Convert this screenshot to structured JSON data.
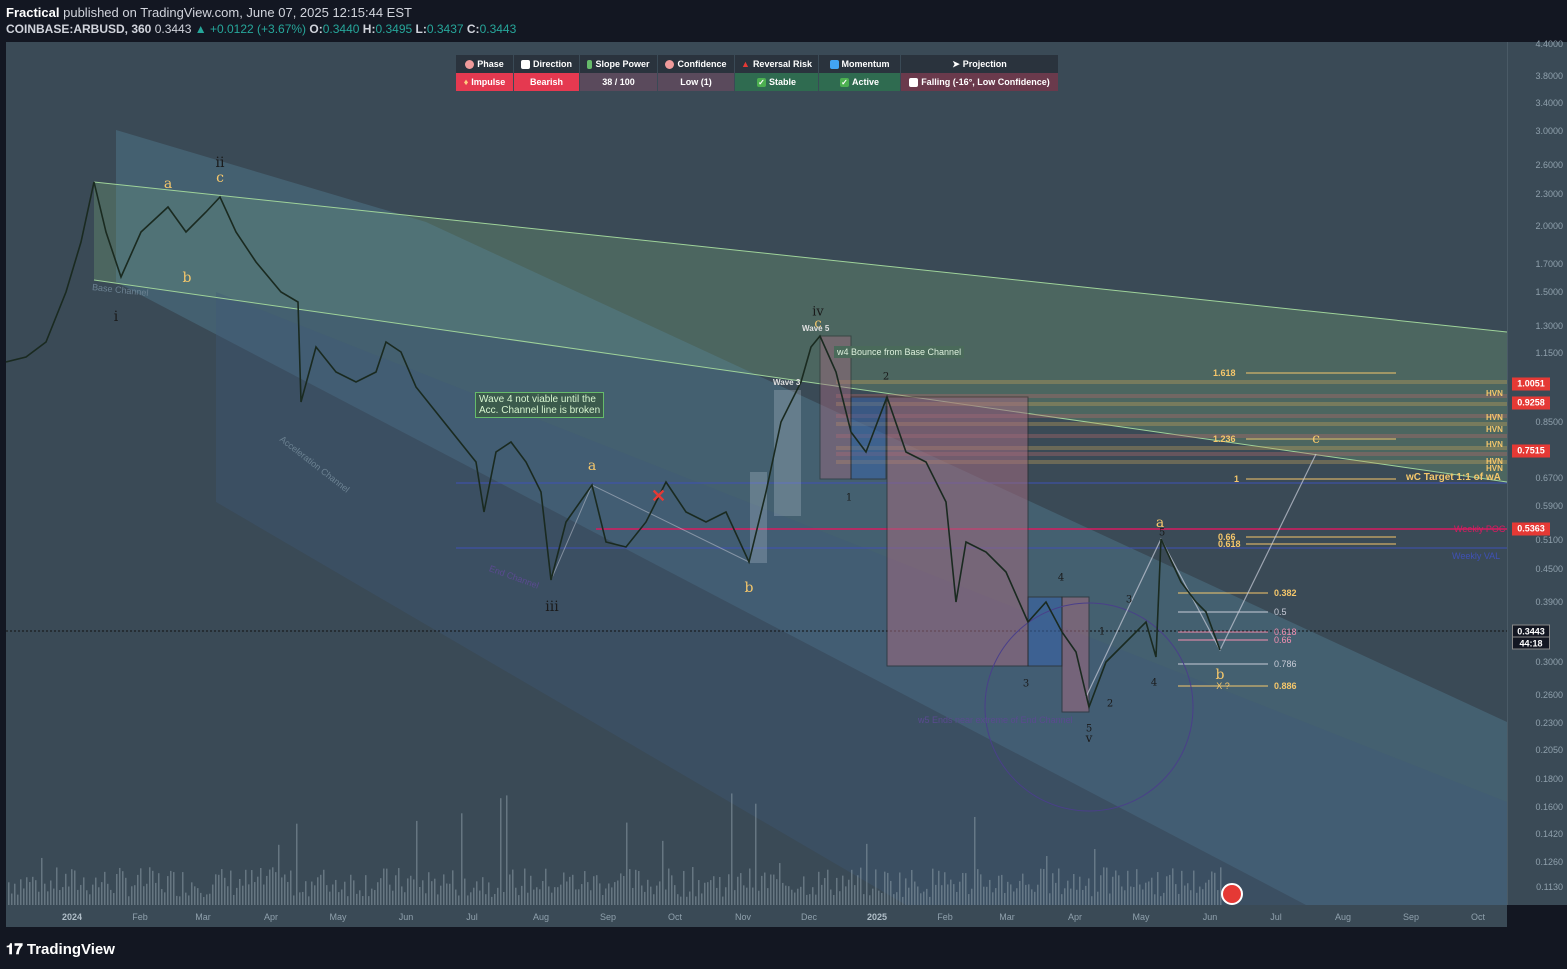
{
  "header": {
    "author": "Fractical",
    "published": "published on TradingView.com, June 07, 2025 12:15:44 EST",
    "symbol": "COINBASE:ARBUSD, 360",
    "last": "0.3443",
    "change": "+0.0122 (+3.67%)",
    "o_label": "O:",
    "o": "0.3440",
    "h_label": "H:",
    "h": "0.3495",
    "l_label": "L:",
    "l": "0.3437",
    "c_label": "C:",
    "c": "0.3443"
  },
  "indicator_table": {
    "headers": [
      {
        "label": "Phase",
        "icon": "brain-icon",
        "color": "#ef9a9a"
      },
      {
        "label": "Direction",
        "icon": "chart-icon",
        "color": "#ffffff"
      },
      {
        "label": "Slope Power",
        "icon": "battery-icon",
        "color": "#66bb6a"
      },
      {
        "label": "Confidence",
        "icon": "brain-icon",
        "color": "#ef9a9a"
      },
      {
        "label": "Reversal Risk",
        "icon": "warning-icon",
        "color": "#e53935"
      },
      {
        "label": "Momentum",
        "icon": "bars-icon",
        "color": "#42a5f5"
      },
      {
        "label": "Projection",
        "icon": "cursor-icon",
        "color": "#ffffff"
      }
    ],
    "values": [
      {
        "label": "Impulse",
        "bg": "#e53950",
        "icon": "fire-icon"
      },
      {
        "label": "Bearish",
        "bg": "#e53950"
      },
      {
        "label": "38 / 100",
        "bg": "#5a4a5c"
      },
      {
        "label": "Low (1)",
        "bg": "#5a4a5c"
      },
      {
        "label": "Stable",
        "bg": "#2f6b50",
        "icon": "check-icon"
      },
      {
        "label": "Active",
        "bg": "#2f6b50",
        "icon": "check-icon"
      },
      {
        "label": "Falling (-16°, Low Confidence)",
        "bg": "#6a3a4c",
        "icon": "chart-icon"
      }
    ]
  },
  "y_axis": {
    "ticks": [
      "4.4000",
      "3.8000",
      "3.4000",
      "3.0000",
      "2.6000",
      "2.3000",
      "2.0000",
      "1.7000",
      "1.5000",
      "1.3000",
      "1.1500",
      "0.8500",
      "0.6700",
      "0.5900",
      "0.5100",
      "0.4500",
      "0.3900",
      "0.3000",
      "0.2600",
      "0.2300",
      "0.2050",
      "0.1800",
      "0.1600",
      "0.1420",
      "0.1260",
      "0.1130"
    ],
    "price_tags": [
      {
        "text": "1.0051",
        "bg": "#e53935"
      },
      {
        "text": "0.9258",
        "bg": "#e53935"
      },
      {
        "text": "0.7515",
        "bg": "#e53935"
      },
      {
        "text": "0.5363",
        "bg": "#e53935"
      },
      {
        "text": "0.3443",
        "bg": "#131722"
      },
      {
        "text": "44:18",
        "bg": "#131722"
      }
    ],
    "hvn_labels": [
      "HVN",
      "HVN",
      "HVN",
      "HVN",
      "HVN",
      "HVN",
      "HVN"
    ]
  },
  "x_axis": {
    "ticks": [
      {
        "t": "2024",
        "year": true
      },
      {
        "t": "Feb"
      },
      {
        "t": "Mar"
      },
      {
        "t": "Apr"
      },
      {
        "t": "May"
      },
      {
        "t": "Jun"
      },
      {
        "t": "Jul"
      },
      {
        "t": "Aug"
      },
      {
        "t": "Sep"
      },
      {
        "t": "Oct"
      },
      {
        "t": "Nov"
      },
      {
        "t": "Dec"
      },
      {
        "t": "2025",
        "year": true
      },
      {
        "t": "Feb"
      },
      {
        "t": "Mar"
      },
      {
        "t": "Apr"
      },
      {
        "t": "May"
      },
      {
        "t": "Jun"
      },
      {
        "t": "Jul"
      },
      {
        "t": "Aug"
      },
      {
        "t": "Sep"
      },
      {
        "t": "Oct"
      }
    ]
  },
  "wave_labels": {
    "i": "i",
    "ii": "ii",
    "iii": "iii",
    "iv": "iv",
    "v": "v",
    "a": "a",
    "b": "b",
    "c": "c",
    "n1": "1",
    "n2": "2",
    "n3": "3",
    "n4": "4",
    "n5": "5",
    "x": "X ?"
  },
  "fib_levels": {
    "f1618": "1.618",
    "f1236": "1.236",
    "f1": "1",
    "f066": "0.66",
    "f0618": "0.618",
    "f0382": "0.382",
    "f05": "0.5",
    "f0618b": "0.618",
    "f066b": "0.66",
    "f0786": "0.786",
    "f0886": "0.886"
  },
  "annotations": {
    "base_channel": "Base Channel",
    "accel_channel": "Acceleration Channel",
    "end_channel": "End Channel",
    "wave4_note_1": "Wave 4 not viable until the",
    "wave4_note_2": "Acc. Channel line is broken",
    "w4_bounce": "w4 Bounce from Base Channel",
    "wave3": "Wave 3",
    "wave5": "Wave 5",
    "wc_target": "wC Target 1:1 of wA",
    "weekly_val": "Weekly VAL",
    "weekly_poc": "Weekly POC",
    "w5_ends": "w5 Ends near extreme of End Channel"
  },
  "footer": {
    "brand": "TradingView"
  }
}
